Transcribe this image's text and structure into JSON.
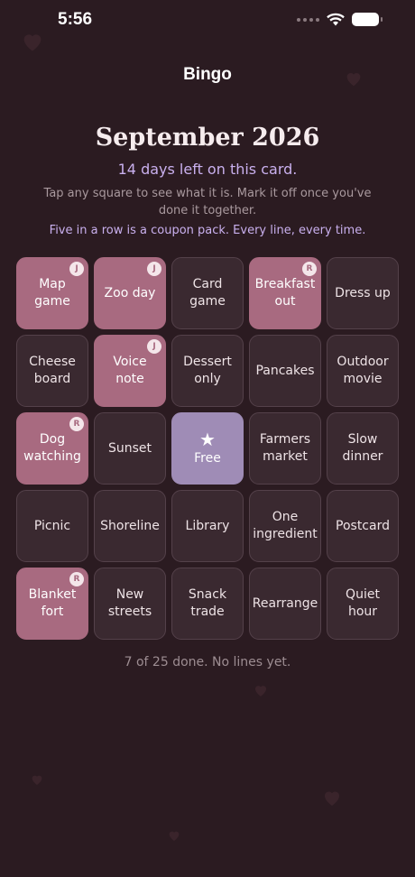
{
  "status_bar": {
    "time": "5:56"
  },
  "nav": {
    "title": "Bingo"
  },
  "header": {
    "month": "September 2026",
    "days_left": "14 days left on this card.",
    "instructions": "Tap any square to see what it is. Mark it off once you've done it together.",
    "rule": "Five in a row is a coupon pack. Every line, every time."
  },
  "grid": {
    "cells": [
      {
        "label": "Map game",
        "done": true,
        "badge": "J"
      },
      {
        "label": "Zoo day",
        "done": true,
        "badge": "J"
      },
      {
        "label": "Card game",
        "done": false,
        "badge": ""
      },
      {
        "label": "Breakfast out",
        "done": true,
        "badge": "R"
      },
      {
        "label": "Dress up",
        "done": false,
        "badge": ""
      },
      {
        "label": "Cheese board",
        "done": false,
        "badge": ""
      },
      {
        "label": "Voice note",
        "done": true,
        "badge": "J"
      },
      {
        "label": "Dessert only",
        "done": false,
        "badge": ""
      },
      {
        "label": "Pancakes",
        "done": false,
        "badge": ""
      },
      {
        "label": "Outdoor movie",
        "done": false,
        "badge": ""
      },
      {
        "label": "Dog watching",
        "done": true,
        "badge": "R"
      },
      {
        "label": "Sunset",
        "done": false,
        "badge": ""
      },
      {
        "label": "Free",
        "done": true,
        "badge": "",
        "free": true,
        "icon": "star-icon"
      },
      {
        "label": "Farmers market",
        "done": false,
        "badge": ""
      },
      {
        "label": "Slow dinner",
        "done": false,
        "badge": ""
      },
      {
        "label": "Picnic",
        "done": false,
        "badge": ""
      },
      {
        "label": "Shoreline",
        "done": false,
        "badge": ""
      },
      {
        "label": "Library",
        "done": false,
        "badge": ""
      },
      {
        "label": "One ingredient",
        "done": false,
        "badge": ""
      },
      {
        "label": "Postcard",
        "done": false,
        "badge": ""
      },
      {
        "label": "Blanket fort",
        "done": true,
        "badge": "R"
      },
      {
        "label": "New streets",
        "done": false,
        "badge": ""
      },
      {
        "label": "Snack trade",
        "done": false,
        "badge": ""
      },
      {
        "label": "Rearrange",
        "done": false,
        "badge": ""
      },
      {
        "label": "Quiet hour",
        "done": false,
        "badge": ""
      }
    ]
  },
  "footer": {
    "progress": "7 of 25 done. No lines yet."
  },
  "colors": {
    "background": "#2b1b21",
    "done": "#a86a80",
    "free": "#9f8cb6",
    "accent_text": "#c9b0ee"
  }
}
